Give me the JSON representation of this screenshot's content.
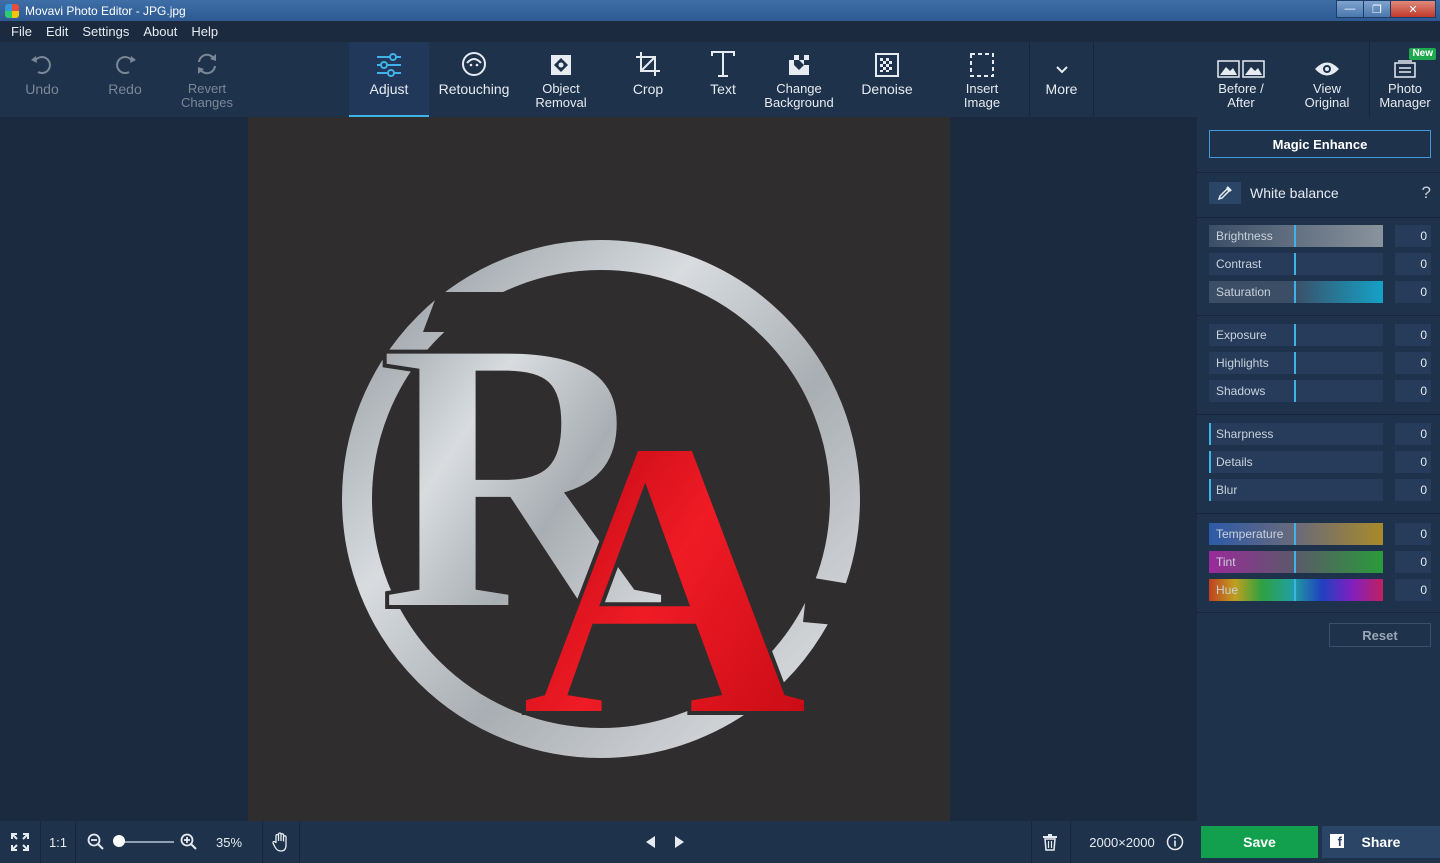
{
  "window": {
    "title": "Movavi Photo Editor - JPG.jpg"
  },
  "menu": {
    "items": [
      "File",
      "Edit",
      "Settings",
      "About",
      "Help"
    ]
  },
  "toolbar": {
    "undo": "Undo",
    "redo": "Redo",
    "revert": "Revert\nChanges",
    "adjust": "Adjust",
    "retouching": "Retouching",
    "object_removal": "Object\nRemoval",
    "crop": "Crop",
    "text": "Text",
    "change_background": "Change\nBackground",
    "denoise": "Denoise",
    "insert_image": "Insert\nImage",
    "more": "More",
    "before_after": "Before /\nAfter",
    "view_original": "View\nOriginal",
    "photo_manager": "Photo\nManager",
    "new_badge": "New"
  },
  "canvas": {
    "logo_letters": [
      "R",
      "A"
    ]
  },
  "panel": {
    "magic_enhance": "Magic Enhance",
    "white_balance": "White balance",
    "help": "?",
    "groups": [
      [
        {
          "name": "Brightness",
          "value": "0"
        },
        {
          "name": "Contrast",
          "value": "0"
        },
        {
          "name": "Saturation",
          "value": "0"
        }
      ],
      [
        {
          "name": "Exposure",
          "value": "0"
        },
        {
          "name": "Highlights",
          "value": "0"
        },
        {
          "name": "Shadows",
          "value": "0"
        }
      ],
      [
        {
          "name": "Sharpness",
          "value": "0"
        },
        {
          "name": "Details",
          "value": "0"
        },
        {
          "name": "Blur",
          "value": "0"
        }
      ],
      [
        {
          "name": "Temperature",
          "value": "0"
        },
        {
          "name": "Tint",
          "value": "0"
        },
        {
          "name": "Hue",
          "value": "0"
        }
      ]
    ],
    "reset": "Reset"
  },
  "status": {
    "one_to_one": "1:1",
    "zoom": "35%",
    "dimensions": "2000×2000",
    "save": "Save",
    "share": "Share"
  },
  "colors": {
    "accent": "#3fb2e8",
    "save_green": "#13a04e",
    "logo_red": "#d0101a"
  }
}
